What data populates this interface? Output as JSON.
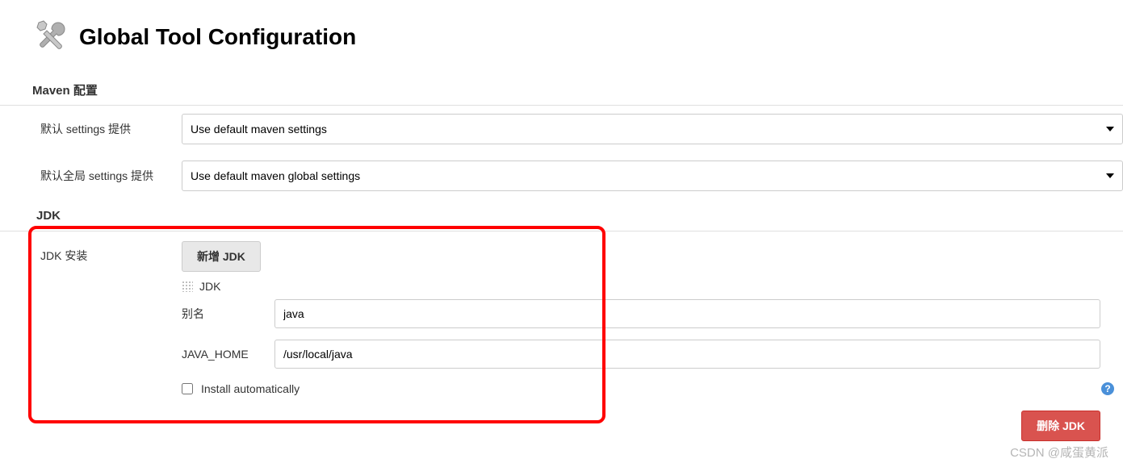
{
  "page": {
    "title": "Global Tool Configuration"
  },
  "maven": {
    "section_heading": "Maven 配置",
    "settings_label": "默认 settings 提供",
    "settings_value": "Use default maven settings",
    "global_settings_label": "默认全局 settings 提供",
    "global_settings_value": "Use default maven global settings"
  },
  "jdk": {
    "section_heading": "JDK",
    "install_label": "JDK 安装",
    "add_button_label": "新增 JDK",
    "entry_heading": "JDK",
    "alias_label": "别名",
    "alias_value": "java",
    "java_home_label": "JAVA_HOME",
    "java_home_value": "/usr/local/java",
    "install_auto_label": "Install automatically",
    "delete_button_label": "删除 JDK"
  },
  "watermark": "CSDN @咸蛋黄派"
}
